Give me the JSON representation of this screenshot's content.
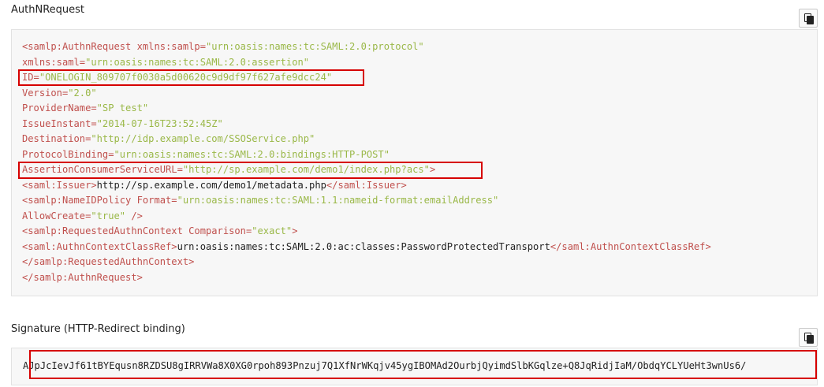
{
  "authn": {
    "title": "AuthNRequest",
    "lines": [
      [
        [
          "tag",
          "<samlp:AuthnRequest xmlns:samlp="
        ],
        [
          "str",
          "\"urn:oasis:names:tc:SAML:2.0:protocol\""
        ]
      ],
      [
        [
          "tag",
          "xmlns:saml="
        ],
        [
          "str",
          "\"urn:oasis:names:tc:SAML:2.0:assertion\""
        ]
      ],
      [
        [
          "tag",
          "ID="
        ],
        [
          "str",
          "\"ONELOGIN_809707f0030a5d00620c9d9df97f627afe9dcc24\""
        ]
      ],
      [
        [
          "tag",
          "Version="
        ],
        [
          "str",
          "\"2.0\""
        ]
      ],
      [
        [
          "tag",
          "ProviderName="
        ],
        [
          "str",
          "\"SP test\""
        ]
      ],
      [
        [
          "tag",
          "IssueInstant="
        ],
        [
          "str",
          "\"2014-07-16T23:52:45Z\""
        ]
      ],
      [
        [
          "tag",
          "Destination="
        ],
        [
          "str",
          "\"http://idp.example.com/SSOService.php\""
        ]
      ],
      [
        [
          "tag",
          "ProtocolBinding="
        ],
        [
          "str",
          "\"urn:oasis:names:tc:SAML:2.0:bindings:HTTP-POST\""
        ]
      ],
      [
        [
          "tag",
          "AssertionConsumerServiceURL="
        ],
        [
          "str",
          "\"http://sp.example.com/demo1/index.php?acs\""
        ],
        [
          "tag",
          ">"
        ]
      ],
      [
        [
          "tag",
          "<saml:Issuer>"
        ],
        [
          "txt",
          "http://sp.example.com/demo1/metadata.php"
        ],
        [
          "tag",
          "</saml:Issuer>"
        ]
      ],
      [
        [
          "tag",
          "<samlp:NameIDPolicy Format="
        ],
        [
          "str",
          "\"urn:oasis:names:tc:SAML:1.1:nameid-format:emailAddress\""
        ]
      ],
      [
        [
          "tag",
          "AllowCreate="
        ],
        [
          "str",
          "\"true\""
        ],
        [
          "tag",
          " />"
        ]
      ],
      [
        [
          "tag",
          "<samlp:RequestedAuthnContext Comparison="
        ],
        [
          "str",
          "\"exact\""
        ],
        [
          "tag",
          ">"
        ]
      ],
      [
        [
          "tag",
          "<saml:AuthnContextClassRef>"
        ],
        [
          "txt",
          "urn:oasis:names:tc:SAML:2.0:ac:classes:PasswordProtectedTransport"
        ],
        [
          "tag",
          "</saml:AuthnContextClassRef>"
        ]
      ],
      [
        [
          "tag",
          "</samlp:RequestedAuthnContext>"
        ]
      ],
      [
        [
          "tag",
          "</samlp:AuthnRequest>"
        ]
      ]
    ]
  },
  "signature": {
    "title": "Signature (HTTP-Redirect binding)",
    "value": "AJpJcIevJf61tBYEqusn8RZDSU8gIRRVWa8X0XG0rpoh893Pnzuj7Q1XfNrWKqjv45ygIBOMAd2OurbjQyimdSlbKGqlze+Q8JqRidjIaM/ObdqYCLYUeHt3wnUs6/"
  },
  "icons": {
    "copy": "copy-icon"
  },
  "colors": {
    "tag": "#c0504d",
    "string": "#9ab848",
    "highlight": "#d60000"
  }
}
